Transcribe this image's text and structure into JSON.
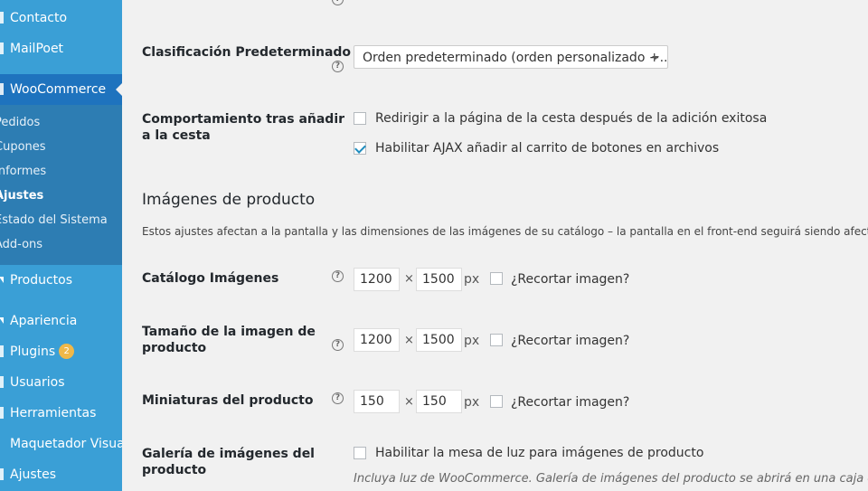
{
  "sidebar": {
    "top_items": [
      {
        "label": "Contacto"
      },
      {
        "label": "MailPoet"
      },
      {
        "label": "WooCommerce"
      }
    ],
    "submenu": [
      {
        "label": "Pedidos"
      },
      {
        "label": "Cupones"
      },
      {
        "label": "Informes"
      },
      {
        "label": "Ajustes"
      },
      {
        "label": "Estado del Sistema"
      },
      {
        "label": "Add-ons"
      }
    ],
    "bottom_items": [
      {
        "label": "Productos"
      },
      {
        "label": "Apariencia"
      },
      {
        "label": "Plugins",
        "badge": "2"
      },
      {
        "label": "Usuarios"
      },
      {
        "label": "Herramientas"
      },
      {
        "label": "Maquetador Visual"
      },
      {
        "label": "Ajustes"
      }
    ]
  },
  "settings": {
    "sorting": {
      "label": "Clasificación Predeterminado",
      "value": "Orden predeterminado (orden personalizado +.."
    },
    "add_to_cart": {
      "label_line1": "Comportamiento tras añadir",
      "label_line2": "a la cesta",
      "option1": "Redirigir a la página de la cesta después de la adición exitosa",
      "option1_checked": false,
      "option2": "Habilitar AJAX añadir al carrito de botones en archivos",
      "option2_checked": true
    },
    "images_section": {
      "title": "Imágenes de producto",
      "description": "Estos ajustes afectan a la pantalla y las dimensiones de las imágenes de su catálogo – la pantalla en el front-end seguirá siendo afecta"
    },
    "catalog_images": {
      "label": "Catálogo Imágenes",
      "width": "1200",
      "height": "1500",
      "unit": "px",
      "times": "×",
      "crop_label": "¿Recortar imagen?"
    },
    "single_image": {
      "label_line1": "Tamaño de la imagen de",
      "label_line2": "producto",
      "width": "1200",
      "height": "1500",
      "unit": "px",
      "times": "×",
      "crop_label": "¿Recortar imagen?"
    },
    "thumbnails": {
      "label": "Miniaturas del producto",
      "width": "150",
      "height": "150",
      "unit": "px",
      "times": "×",
      "crop_label": "¿Recortar imagen?"
    },
    "gallery": {
      "label_line1": "Galería de imágenes del",
      "label_line2": "producto",
      "option": "Habilitar la mesa de luz para imágenes de producto",
      "note": "Incluya luz de WooCommerce. Galería de imágenes del producto se abrirá en una caja de luz"
    }
  },
  "colors": {
    "sidebar": "#3a9fd6",
    "sidebar_current": "#1e73be",
    "submenu": "#2d7db3",
    "badge": "#f0b849"
  }
}
